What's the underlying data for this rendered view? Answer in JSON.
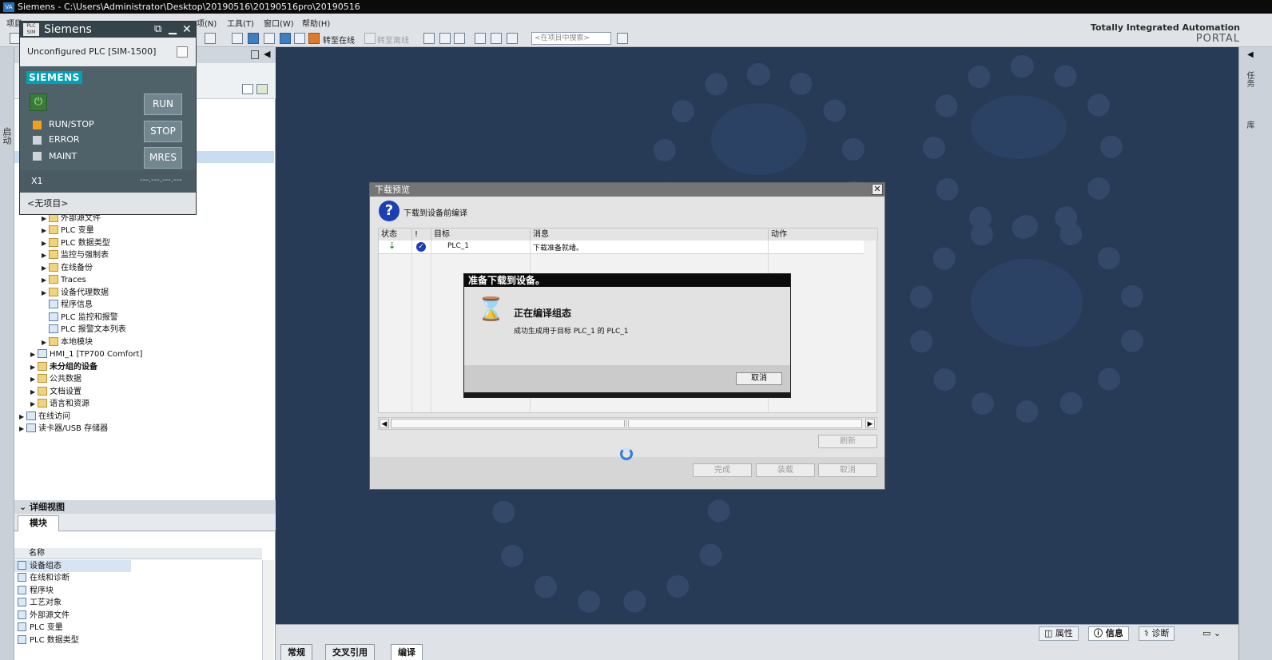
{
  "window": {
    "app_icon": "VA",
    "title": "Siemens - C:\\Users\\Administrator\\Desktop\\20190516\\20190516pro\\20190516"
  },
  "menu": {
    "items": [
      "项目",
      "项(N)",
      "工具(T)",
      "窗口(W)",
      "帮助(H)"
    ]
  },
  "toolbar": {
    "go_online": "转至在线",
    "go_offline": "转至离线",
    "search_placeholder": "<在项目中搜索>"
  },
  "brand": {
    "line1": "Totally Integrated Automation",
    "line2": "PORTAL"
  },
  "left_strip": {
    "label": "启动"
  },
  "right_strip": {
    "label1": "任务",
    "label2": "库"
  },
  "plcsim": {
    "badge": "PLC SIM",
    "title": "Siemens",
    "device": "Unconfigured PLC [SIM-1500]",
    "logo": "SIEMENS",
    "leds": [
      {
        "label": "RUN/STOP",
        "color": "#f2a11f"
      },
      {
        "label": "ERROR",
        "color": "#cfd3d5"
      },
      {
        "label": "MAINT",
        "color": "#cfd3d5"
      }
    ],
    "buttons": [
      "RUN",
      "STOP",
      "MRES"
    ],
    "interface": "X1",
    "ip": "---.---.---.---",
    "project": "<无项目>"
  },
  "tree": {
    "rows": [
      {
        "label": "外部源文件",
        "indent": 3
      },
      {
        "label": "PLC 变量",
        "indent": 3
      },
      {
        "label": "PLC 数据类型",
        "indent": 3
      },
      {
        "label": "监控与强制表",
        "indent": 3
      },
      {
        "label": "在线备份",
        "indent": 3
      },
      {
        "label": "Traces",
        "indent": 3
      },
      {
        "label": "设备代理数据",
        "indent": 3
      },
      {
        "label": "程序信息",
        "indent": 3
      },
      {
        "label": "PLC 监控和报警",
        "indent": 3
      },
      {
        "label": "PLC 报警文本列表",
        "indent": 3
      },
      {
        "label": "本地模块",
        "indent": 3
      },
      {
        "label": "HMI_1 [TP700 Comfort]",
        "indent": 2
      },
      {
        "label": "未分组的设备",
        "indent": 2
      },
      {
        "label": "公共数据",
        "indent": 2
      },
      {
        "label": "文档设置",
        "indent": 2
      },
      {
        "label": "语言和资源",
        "indent": 2
      },
      {
        "label": "在线访问",
        "indent": 1
      },
      {
        "label": "读卡器/USB 存储器",
        "indent": 1
      }
    ]
  },
  "details": {
    "header": "详细视图",
    "tab": "模块",
    "column_name": "名称",
    "items": [
      "设备组态",
      "在线和诊断",
      "程序块",
      "工艺对象",
      "外部源文件",
      "PLC 变量",
      "PLC 数据类型"
    ]
  },
  "inspector": {
    "tabs": [
      "属性",
      "信息",
      "诊断"
    ],
    "bottom_tabs": [
      "常规",
      "交叉引用",
      "编译"
    ]
  },
  "download_dialog": {
    "title": "下载预览",
    "subtitle": "下载到设备前编译",
    "columns": [
      "状态",
      "!",
      "目标",
      "消息",
      "动作"
    ],
    "row": {
      "target": "PLC_1",
      "message": "下载准备就绪。"
    },
    "refresh": "刷新",
    "finish": "完成",
    "load": "装载",
    "cancel": "取消"
  },
  "progress_popup": {
    "title": "准备下载到设备。",
    "heading": "正在编译组态",
    "detail": "成功生成用于目标 PLC_1 的 PLC_1",
    "cancel": "取消"
  }
}
